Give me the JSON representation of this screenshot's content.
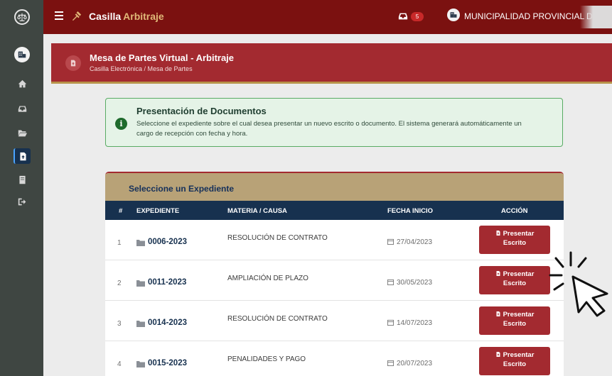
{
  "topbar": {
    "brand_part1": "Casilla",
    "brand_part2": "Arbitraje",
    "notification_count": "5",
    "org_name": "MUNICIPALIDAD PROVINCIAL DE"
  },
  "sidebar": {
    "items": [
      {
        "icon": "home-icon"
      },
      {
        "icon": "inbox-icon"
      },
      {
        "icon": "folder-open-icon"
      },
      {
        "icon": "file-upload-icon",
        "active": true
      },
      {
        "icon": "book-icon"
      },
      {
        "icon": "sign-out-icon"
      }
    ]
  },
  "header": {
    "title": "Mesa de Partes Virtual - Arbitraje",
    "breadcrumb": "Casilla Electrónica / Mesa de Partes"
  },
  "info": {
    "title": "Presentación de Documentos",
    "text": "Seleccione el expediente sobre el cual desea presentar un nuevo escrito o documento. El sistema generará automáticamente un cargo de recepción con fecha y hora."
  },
  "table": {
    "title": "Seleccione un Expediente",
    "columns": [
      "#",
      "EXPEDIENTE",
      "MATERIA / CAUSA",
      "FECHA INICIO",
      "ACCIÓN"
    ],
    "action_label_line1": "Presentar",
    "action_label_line2": "Escrito",
    "rows": [
      {
        "num": "1",
        "expediente": "0006-2023",
        "materia": "RESOLUCIÓN DE CONTRATO",
        "fecha": "27/04/2023"
      },
      {
        "num": "2",
        "expediente": "0011-2023",
        "materia": "AMPLIACIÓN DE PLAZO",
        "fecha": "30/05/2023"
      },
      {
        "num": "3",
        "expediente": "0014-2023",
        "materia": "RESOLUCIÓN DE CONTRATO",
        "fecha": "14/07/2023"
      },
      {
        "num": "4",
        "expediente": "0015-2023",
        "materia": "PENALIDADES Y PAGO",
        "fecha": "20/07/2023"
      }
    ]
  },
  "colors": {
    "topbar": "#7b1110",
    "header": "#a32a30",
    "accent_gold": "#b8a277",
    "navy": "#17314f",
    "sidebar": "#3f4642"
  }
}
